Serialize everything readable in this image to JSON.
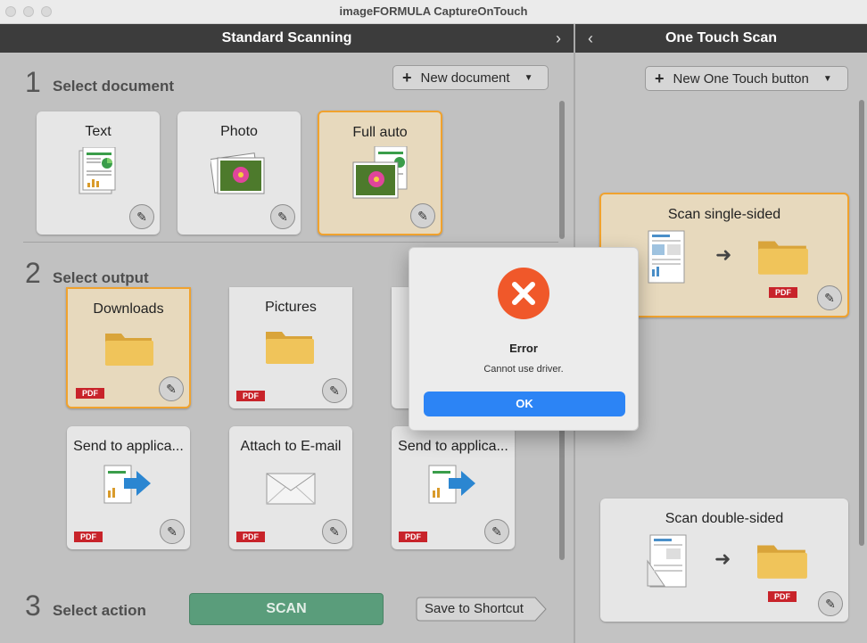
{
  "window": {
    "title": "imageFORMULA CaptureOnTouch"
  },
  "left_panel": {
    "header": "Standard Scanning",
    "step1": {
      "num": "1",
      "label": "Select document",
      "new_button": "New document"
    },
    "documents": [
      {
        "label": "Text",
        "selected": false
      },
      {
        "label": "Photo",
        "selected": false
      },
      {
        "label": "Full auto",
        "selected": true
      }
    ],
    "step2": {
      "num": "2",
      "label": "Select output"
    },
    "outputs": [
      {
        "label": "Downloads",
        "badge": "PDF",
        "selected": true
      },
      {
        "label": "Pictures",
        "badge": "PDF",
        "selected": false
      },
      {
        "label": "Send to applica...",
        "badge": "PDF",
        "selected": false
      },
      {
        "label": "Attach to E-mail",
        "badge": "PDF",
        "selected": false
      },
      {
        "label": "Send to applica...",
        "badge": "PDF",
        "selected": false
      }
    ],
    "step3": {
      "num": "3",
      "label": "Select action"
    },
    "scan_button": "SCAN",
    "shortcut_button": "Save to Shortcut"
  },
  "right_panel": {
    "header": "One Touch Scan",
    "new_button": "New One Touch button",
    "items": [
      {
        "label": "Scan single-sided",
        "badge": "PDF",
        "selected": true
      },
      {
        "label": "Scan double-sided",
        "badge": "PDF",
        "selected": false
      }
    ]
  },
  "dialog": {
    "title": "Error",
    "message": "Cannot use driver.",
    "ok_label": "OK"
  },
  "colors": {
    "accent": "#f0a22e",
    "scan_green": "#5a9d7b",
    "error_orange": "#f0582a",
    "ok_blue": "#2c84f5",
    "pdf_red": "#c8232a"
  },
  "icons": {
    "document_text": "text-document-icon",
    "photo": "photo-icon",
    "folder": "folder-icon",
    "send": "send-to-app-icon",
    "mail": "envelope-icon",
    "edit": "pencil-icon",
    "error": "error-x-icon"
  }
}
